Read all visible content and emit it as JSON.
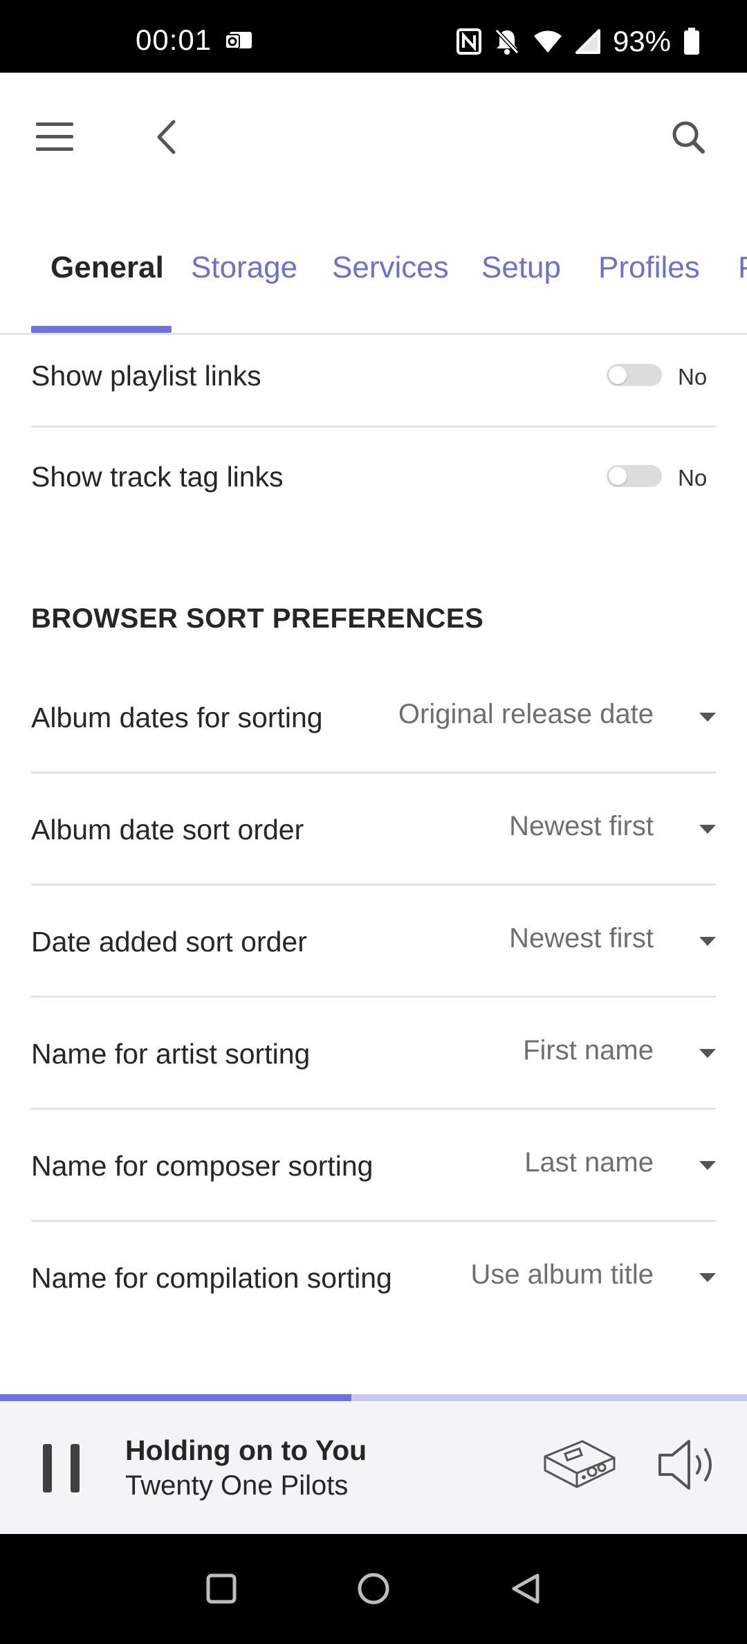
{
  "status_bar": {
    "time": "00:01",
    "battery": "93%",
    "icons": [
      "outlook-icon",
      "nfc-icon",
      "bell-off-icon",
      "wifi-icon",
      "signal-icon",
      "battery-icon"
    ]
  },
  "app_bar": {
    "icons": [
      "menu-icon",
      "back-icon",
      "search-icon"
    ]
  },
  "tabs": [
    {
      "label": "General",
      "active": true
    },
    {
      "label": "Storage",
      "active": false
    },
    {
      "label": "Services",
      "active": false
    },
    {
      "label": "Setup",
      "active": false
    },
    {
      "label": "Profiles",
      "active": false
    },
    {
      "label": "P",
      "active": false
    }
  ],
  "toggles": [
    {
      "label": "Show playlist links",
      "state": "No",
      "on": false
    },
    {
      "label": "Show track tag links",
      "state": "No",
      "on": false
    }
  ],
  "section": {
    "title": "BROWSER SORT PREFERENCES"
  },
  "selects": [
    {
      "label": "Album dates for sorting",
      "value": "Original release date"
    },
    {
      "label": "Album date sort order",
      "value": "Newest first"
    },
    {
      "label": "Date added sort order",
      "value": "Newest first"
    },
    {
      "label": "Name for artist sorting",
      "value": "First name"
    },
    {
      "label": "Name for composer sorting",
      "value": "Last name"
    },
    {
      "label": "Name for compilation sorting",
      "value": "Use album title"
    }
  ],
  "now_playing": {
    "title": "Holding on to You",
    "artist": "Twenty One Pilots",
    "progress": 0.47,
    "colors": {
      "accent": "#6e70e3",
      "track": "#c7c8f2"
    }
  },
  "nav_bar": {
    "icons": [
      "recents-icon",
      "home-icon",
      "back-triangle-icon"
    ]
  }
}
